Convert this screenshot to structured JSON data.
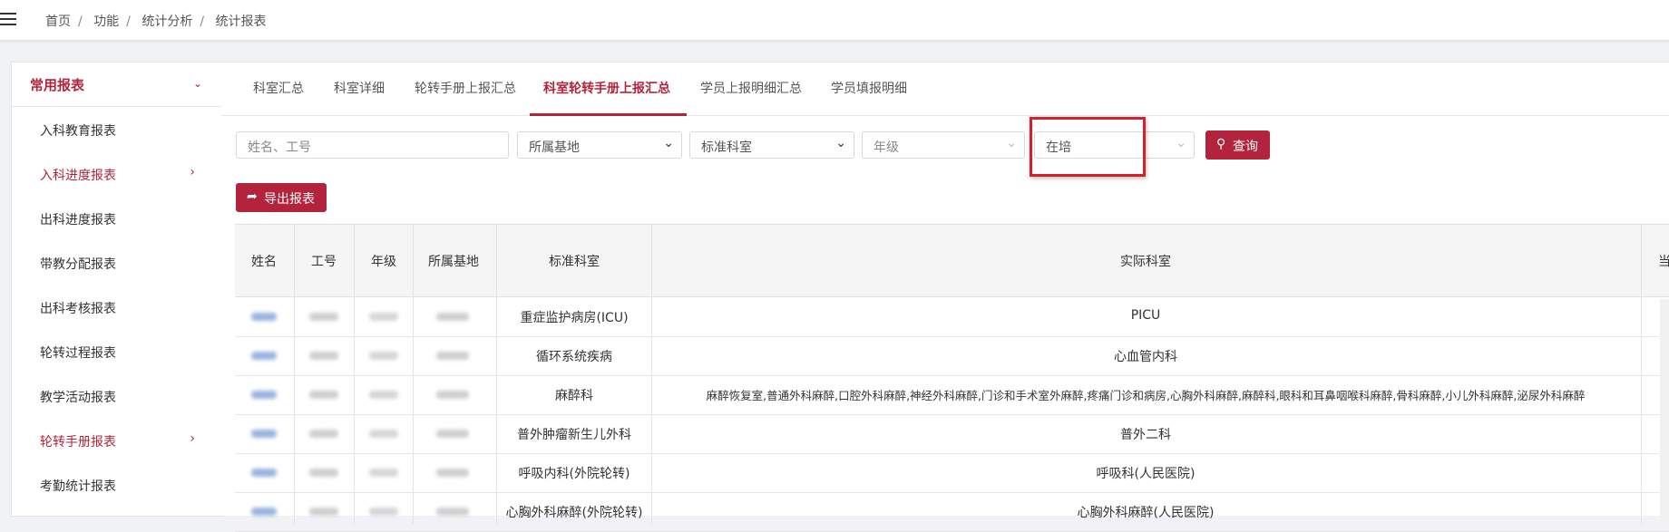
{
  "breadcrumb": [
    "首页",
    "功能",
    "统计分析",
    "统计报表"
  ],
  "sidebar": {
    "title": "常用报表",
    "items": [
      {
        "label": "入科教育报表",
        "active": false
      },
      {
        "label": "入科进度报表",
        "active": true
      },
      {
        "label": "出科进度报表",
        "active": false
      },
      {
        "label": "带教分配报表",
        "active": false
      },
      {
        "label": "出科考核报表",
        "active": false
      },
      {
        "label": "轮转过程报表",
        "active": false
      },
      {
        "label": "教学活动报表",
        "active": false
      },
      {
        "label": "轮转手册报表",
        "active": true
      },
      {
        "label": "考勤统计报表",
        "active": false
      }
    ]
  },
  "tabs": [
    "科室汇总",
    "科室详细",
    "轮转手册上报汇总",
    "科室轮转手册上报汇总",
    "学员上报明细汇总",
    "学员填报明细"
  ],
  "active_tab": 3,
  "filters": {
    "name_placeholder": "姓名、工号",
    "base": "所属基地",
    "dept": "标准科室",
    "grade": "年级",
    "status": "在培"
  },
  "buttons": {
    "search": "查询",
    "export": "导出报表"
  },
  "table": {
    "columns": [
      "姓名",
      "工号",
      "年级",
      "所属基地",
      "标准科室",
      "实际科室",
      "当"
    ],
    "rows": [
      {
        "std": "重症监护病房(ICU)",
        "actual": "PICU"
      },
      {
        "std": "循环系统疾病",
        "actual": "心血管内科"
      },
      {
        "std": "麻醉科",
        "actual": "麻醉恢复室,普通外科麻醉,口腔外科麻醉,神经外科麻醉,门诊和手术室外麻醉,疼痛门诊和病房,心胸外科麻醉,麻醉科,眼科和耳鼻咽喉科麻醉,骨科麻醉,小儿外科麻醉,泌尿外科麻醉"
      },
      {
        "std": "普外肿瘤新生儿外科",
        "actual": "普外二科"
      },
      {
        "std": "呼吸内科(外院轮转)",
        "actual": "呼吸科(人民医院)"
      },
      {
        "std": "心胸外科麻醉(外院轮转)",
        "actual": "心胸外科麻醉(人民医院)"
      }
    ]
  },
  "colors": {
    "accent": "#b3243c",
    "highlight": "#d71f2b"
  }
}
